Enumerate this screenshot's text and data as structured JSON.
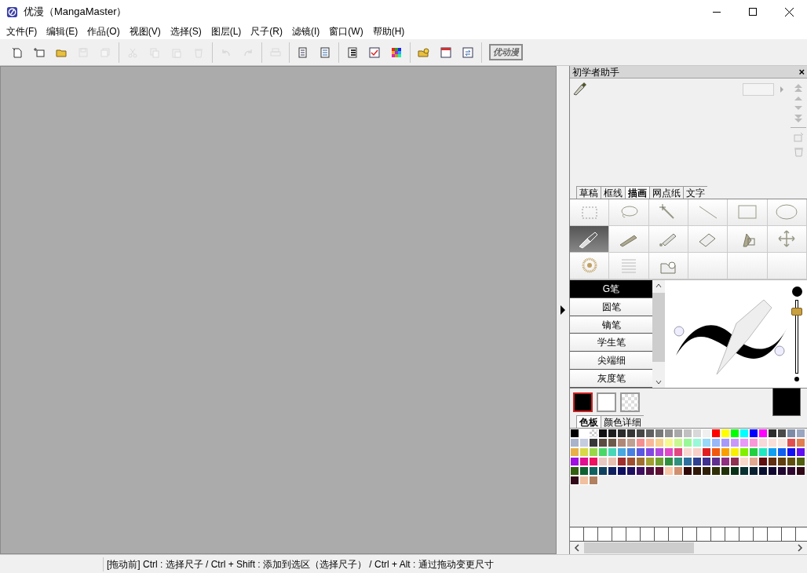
{
  "window": {
    "title": "优漫（MangaMaster）"
  },
  "menu": [
    "文件(F)",
    "编辑(E)",
    "作品(O)",
    "视图(V)",
    "选择(S)",
    "图层(L)",
    "尺子(R)",
    "滤镜(I)",
    "窗口(W)",
    "帮助(H)"
  ],
  "toolbar": [
    [
      {
        "disabled": false
      },
      {
        "disabled": false
      },
      {
        "disabled": false
      },
      {
        "disabled": true
      },
      {
        "disabled": true
      }
    ],
    [
      {
        "disabled": true
      },
      {
        "disabled": true
      },
      {
        "disabled": true
      },
      {
        "disabled": true
      }
    ],
    [
      {
        "disabled": true
      },
      {
        "disabled": true
      }
    ],
    [
      {
        "disabled": true
      }
    ],
    [
      {
        "disabled": false
      },
      {
        "disabled": false
      }
    ],
    [
      {
        "disabled": false
      },
      {
        "disabled": false
      },
      {
        "disabled": false
      }
    ],
    [
      {
        "disabled": false
      },
      {
        "disabled": false
      },
      {
        "disabled": false
      }
    ],
    [
      {
        "disabled": false,
        "label": "优动漫"
      }
    ]
  ],
  "panel": {
    "title": "初学者助手",
    "close": "×",
    "tool_tabs": [
      {
        "label": "草稿",
        "selected": false
      },
      {
        "label": "框线",
        "selected": false
      },
      {
        "label": "描画",
        "selected": true
      },
      {
        "label": "网点纸",
        "selected": false
      },
      {
        "label": "文字",
        "selected": false
      }
    ],
    "tools": [
      {
        "selected": false
      },
      {
        "selected": false
      },
      {
        "selected": false
      },
      {
        "selected": false
      },
      {
        "selected": false
      },
      {
        "selected": false
      },
      {
        "selected": true
      },
      {
        "selected": false
      },
      {
        "selected": false
      },
      {
        "selected": false
      },
      {
        "selected": false
      },
      {
        "selected": false
      },
      {
        "selected": false
      },
      {
        "selected": false
      },
      {
        "selected": false
      }
    ],
    "subtools": [
      {
        "label": "G笔",
        "selected": true
      },
      {
        "label": "圆笔",
        "selected": false
      },
      {
        "label": "镝笔",
        "selected": false
      },
      {
        "label": "学生笔",
        "selected": false
      },
      {
        "label": "尖端细",
        "selected": false
      },
      {
        "label": "灰度笔",
        "selected": false
      }
    ],
    "brush_size": {
      "level": 0.88
    },
    "colors": [
      {
        "kind": "solid",
        "color": "#000000",
        "selected": true
      },
      {
        "kind": "solid",
        "color": "#ffffff",
        "selected": false
      },
      {
        "kind": "transparent",
        "selected": false
      }
    ],
    "current_color": {
      "color": "#000000"
    },
    "color_tabs": [
      {
        "label": "色板",
        "selected": true
      },
      {
        "label": "颜色详细",
        "selected": false
      }
    ],
    "swatches": [
      {
        "color": "#000000"
      },
      {
        "color": "#ffffff"
      },
      {
        "kind": "transparent"
      },
      {
        "color": "#111111"
      },
      {
        "color": "#1e1e1e"
      },
      {
        "color": "#2b2b2b"
      },
      {
        "color": "#363636"
      },
      {
        "color": "#474747"
      },
      {
        "color": "#606060"
      },
      {
        "color": "#787878"
      },
      {
        "color": "#909090"
      },
      {
        "color": "#a8a8a8"
      },
      {
        "color": "#c0c0c0"
      },
      {
        "color": "#d8d8d8"
      },
      {
        "color": "#f0f0f0"
      },
      {
        "color": "#ff0000"
      },
      {
        "color": "#ffff00"
      },
      {
        "color": "#00ff00"
      },
      {
        "color": "#00ffff"
      },
      {
        "color": "#0000ff"
      },
      {
        "color": "#ff00ff"
      },
      {
        "color": "#2d2d2d"
      },
      {
        "color": "#4a4a4a"
      },
      {
        "color": "#7d8ca6"
      },
      {
        "color": "#9aa6c0"
      },
      {
        "color": "#a9b3c9"
      },
      {
        "color": "#c5cce0"
      },
      {
        "color": "#383838"
      },
      {
        "color": "#5a4a40"
      },
      {
        "color": "#6e5a48"
      },
      {
        "color": "#b08878"
      },
      {
        "color": "#c0a090"
      },
      {
        "color": "#f49090"
      },
      {
        "color": "#f8b898"
      },
      {
        "color": "#f8d090"
      },
      {
        "color": "#f8f890"
      },
      {
        "color": "#c8f890"
      },
      {
        "color": "#98f898"
      },
      {
        "color": "#98f8d8"
      },
      {
        "color": "#98d8f8"
      },
      {
        "color": "#98b8f8"
      },
      {
        "color": "#a898f8"
      },
      {
        "color": "#c898f8"
      },
      {
        "color": "#e898f8"
      },
      {
        "color": "#f898d8"
      },
      {
        "color": "#f8d8d8"
      },
      {
        "color": "#f8e0d8"
      },
      {
        "color": "#f8e8e0"
      },
      {
        "color": "#e05050"
      },
      {
        "color": "#e08050"
      },
      {
        "color": "#e8b048"
      },
      {
        "color": "#d8d848"
      },
      {
        "color": "#98d848"
      },
      {
        "color": "#48d868"
      },
      {
        "color": "#48d8b8"
      },
      {
        "color": "#48a8e0"
      },
      {
        "color": "#4880e0"
      },
      {
        "color": "#5858e0"
      },
      {
        "color": "#8048e0"
      },
      {
        "color": "#b048e0"
      },
      {
        "color": "#e048c8"
      },
      {
        "color": "#e04880"
      },
      {
        "color": "#f8d8d0"
      },
      {
        "color": "#f8d0c8"
      },
      {
        "color": "#e02020"
      },
      {
        "color": "#f05810"
      },
      {
        "color": "#f8a000"
      },
      {
        "color": "#f8f000"
      },
      {
        "color": "#80f000"
      },
      {
        "color": "#20d040"
      },
      {
        "color": "#20e8c0"
      },
      {
        "color": "#10a0f0"
      },
      {
        "color": "#1060f0"
      },
      {
        "color": "#1010f0"
      },
      {
        "color": "#6010f0"
      },
      {
        "color": "#a010e0"
      },
      {
        "color": "#e01090"
      },
      {
        "color": "#f01060"
      },
      {
        "color": "#e8c8c0"
      },
      {
        "color": "#e8c0b0"
      },
      {
        "color": "#a03030"
      },
      {
        "color": "#a05030"
      },
      {
        "color": "#a07030"
      },
      {
        "color": "#a0a030"
      },
      {
        "color": "#70a030"
      },
      {
        "color": "#309040"
      },
      {
        "color": "#309080"
      },
      {
        "color": "#3070a0"
      },
      {
        "color": "#304090"
      },
      {
        "color": "#403090"
      },
      {
        "color": "#603090"
      },
      {
        "color": "#903080"
      },
      {
        "color": "#903050"
      },
      {
        "color": "#f8d8c8"
      },
      {
        "color": "#e0a890"
      },
      {
        "color": "#601010"
      },
      {
        "color": "#603010"
      },
      {
        "color": "#604010"
      },
      {
        "color": "#605010"
      },
      {
        "color": "#506010"
      },
      {
        "color": "#306010"
      },
      {
        "color": "#106030"
      },
      {
        "color": "#106060"
      },
      {
        "color": "#104060"
      },
      {
        "color": "#102060"
      },
      {
        "color": "#101060"
      },
      {
        "color": "#201060"
      },
      {
        "color": "#401060"
      },
      {
        "color": "#501040"
      },
      {
        "color": "#601030"
      },
      {
        "color": "#f8c8a8"
      },
      {
        "color": "#d09070"
      },
      {
        "color": "#300808"
      },
      {
        "color": "#301808"
      },
      {
        "color": "#302008"
      },
      {
        "color": "#303008"
      },
      {
        "color": "#203008"
      },
      {
        "color": "#083018"
      },
      {
        "color": "#083030"
      },
      {
        "color": "#082030"
      },
      {
        "color": "#081030"
      },
      {
        "color": "#100830"
      },
      {
        "color": "#200830"
      },
      {
        "color": "#300830"
      },
      {
        "color": "#300818"
      },
      {
        "color": "#300818"
      },
      {
        "color": "#f0c0a0"
      },
      {
        "color": "#b08060"
      }
    ]
  },
  "status_bar": "[拖动前] Ctrl : 选择尺子 / Ctrl + Shift : 添加到选区（选择尺子） / Ctrl + Alt : 通过拖动变更尺寸"
}
